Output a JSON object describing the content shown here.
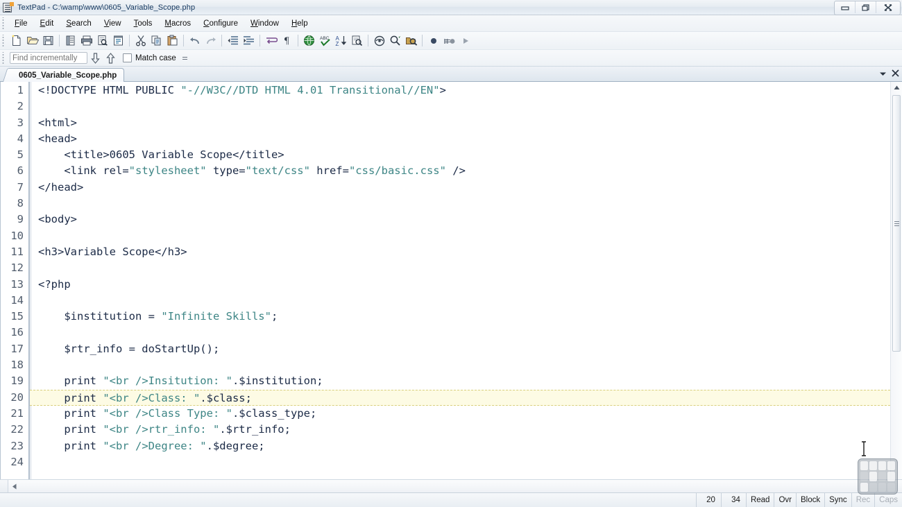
{
  "window": {
    "title": "TextPad - C:\\wamp\\www\\0605_Variable_Scope.php",
    "app_icon": "textpad-icon",
    "controls": {
      "minimize": "minimize-button",
      "restore": "restore-button",
      "close": "close-button"
    }
  },
  "menubar": {
    "items": [
      {
        "label": "File",
        "accel": "F"
      },
      {
        "label": "Edit",
        "accel": "E"
      },
      {
        "label": "Search",
        "accel": "S"
      },
      {
        "label": "View",
        "accel": "V"
      },
      {
        "label": "Tools",
        "accel": "T"
      },
      {
        "label": "Macros",
        "accel": "M"
      },
      {
        "label": "Configure",
        "accel": "C"
      },
      {
        "label": "Window",
        "accel": "W"
      },
      {
        "label": "Help",
        "accel": "H"
      }
    ]
  },
  "toolbar": {
    "buttons": [
      "new-file-icon",
      "open-file-icon",
      "save-file-icon",
      "sep",
      "document-properties-icon",
      "print-icon",
      "print-preview-icon",
      "document-view-icon",
      "sep",
      "cut-icon",
      "copy-icon",
      "paste-icon",
      "sep",
      "undo-icon",
      "redo-icon",
      "sep",
      "decrease-indent-icon",
      "increase-indent-icon",
      "sep",
      "word-wrap-icon",
      "show-paragraph-marks-icon",
      "sep",
      "web-preview-icon",
      "spell-check-icon",
      "sort-icon",
      "find-in-files-icon",
      "sep",
      "clip-library-icon",
      "find-next-icon",
      "find-tool-icon",
      "sep",
      "record-macro-icon",
      "pause-macro-icon",
      "play-macro-icon"
    ]
  },
  "findbar": {
    "input_value": "",
    "input_placeholder": "Find incrementally",
    "find_down_icon": "arrow-down-icon",
    "find_up_icon": "arrow-up-icon",
    "match_case_label": "Match case",
    "match_case_checked": false
  },
  "tabbar": {
    "tabs": [
      {
        "label": "0605_Variable_Scope.php",
        "active": true
      }
    ],
    "dropdown_icon": "chevron-down-icon",
    "close_icon": "close-icon"
  },
  "editor": {
    "current_line": 20,
    "lines": [
      {
        "n": "1",
        "tokens": [
          {
            "t": "<!DOCTYPE HTML PUBLIC ",
            "c": "txt"
          },
          {
            "t": "\"-//W3C//DTD HTML 4.01 Transitional//EN\"",
            "c": "str"
          },
          {
            "t": ">",
            "c": "txt"
          }
        ]
      },
      {
        "n": "2",
        "tokens": [
          {
            "t": "",
            "c": "txt"
          }
        ]
      },
      {
        "n": "3",
        "tokens": [
          {
            "t": "<html>",
            "c": "txt"
          }
        ]
      },
      {
        "n": "4",
        "tokens": [
          {
            "t": "<head>",
            "c": "txt"
          }
        ]
      },
      {
        "n": "5",
        "tokens": [
          {
            "t": "    <title>0605 Variable Scope</title>",
            "c": "txt"
          }
        ]
      },
      {
        "n": "6",
        "tokens": [
          {
            "t": "    <link rel=",
            "c": "txt"
          },
          {
            "t": "\"stylesheet\"",
            "c": "str"
          },
          {
            "t": " type=",
            "c": "txt"
          },
          {
            "t": "\"text/css\"",
            "c": "str"
          },
          {
            "t": " href=",
            "c": "txt"
          },
          {
            "t": "\"css/basic.css\"",
            "c": "str"
          },
          {
            "t": " />",
            "c": "txt"
          }
        ]
      },
      {
        "n": "7",
        "tokens": [
          {
            "t": "</head>",
            "c": "txt"
          }
        ]
      },
      {
        "n": "8",
        "tokens": [
          {
            "t": "",
            "c": "txt"
          }
        ]
      },
      {
        "n": "9",
        "tokens": [
          {
            "t": "<body>",
            "c": "txt"
          }
        ]
      },
      {
        "n": "10",
        "tokens": [
          {
            "t": "",
            "c": "txt"
          }
        ]
      },
      {
        "n": "11",
        "tokens": [
          {
            "t": "<h3>Variable Scope</h3>",
            "c": "txt"
          }
        ]
      },
      {
        "n": "12",
        "tokens": [
          {
            "t": "",
            "c": "txt"
          }
        ]
      },
      {
        "n": "13",
        "tokens": [
          {
            "t": "<?php",
            "c": "txt"
          }
        ]
      },
      {
        "n": "14",
        "tokens": [
          {
            "t": "",
            "c": "txt"
          }
        ]
      },
      {
        "n": "15",
        "tokens": [
          {
            "t": "    $institution = ",
            "c": "txt"
          },
          {
            "t": "\"Infinite Skills\"",
            "c": "str"
          },
          {
            "t": ";",
            "c": "txt"
          }
        ]
      },
      {
        "n": "16",
        "tokens": [
          {
            "t": "",
            "c": "txt"
          }
        ]
      },
      {
        "n": "17",
        "tokens": [
          {
            "t": "    $rtr_info = doStartUp();",
            "c": "txt"
          }
        ]
      },
      {
        "n": "18",
        "tokens": [
          {
            "t": "",
            "c": "txt"
          }
        ]
      },
      {
        "n": "19",
        "tokens": [
          {
            "t": "    print ",
            "c": "txt"
          },
          {
            "t": "\"<br />Insitution: \"",
            "c": "str"
          },
          {
            "t": ".$institution;",
            "c": "txt"
          }
        ]
      },
      {
        "n": "20",
        "tokens": [
          {
            "t": "    print ",
            "c": "txt"
          },
          {
            "t": "\"<br />Class: \"",
            "c": "str"
          },
          {
            "t": ".$class;",
            "c": "txt"
          }
        ]
      },
      {
        "n": "21",
        "tokens": [
          {
            "t": "    print ",
            "c": "txt"
          },
          {
            "t": "\"<br />Class Type: \"",
            "c": "str"
          },
          {
            "t": ".$class_type;",
            "c": "txt"
          }
        ]
      },
      {
        "n": "22",
        "tokens": [
          {
            "t": "    print ",
            "c": "txt"
          },
          {
            "t": "\"<br />rtr_info: \"",
            "c": "str"
          },
          {
            "t": ".$rtr_info;",
            "c": "txt"
          }
        ]
      },
      {
        "n": "23",
        "tokens": [
          {
            "t": "    print ",
            "c": "txt"
          },
          {
            "t": "\"<br />Degree: \"",
            "c": "str"
          },
          {
            "t": ".$degree;",
            "c": "txt"
          }
        ]
      },
      {
        "n": "24",
        "tokens": [
          {
            "t": "",
            "c": "txt"
          }
        ]
      }
    ],
    "colors": {
      "string": "#3d8585",
      "text": "#1b2a46",
      "current_line_bg": "#fdfbe4",
      "gutter_text": "#4f5b6b"
    }
  },
  "statusbar": {
    "line": "20",
    "column": "34",
    "read_mode": "Read",
    "overwrite_mode": "Ovr",
    "block_mode": "Block",
    "sync_mode": "Sync",
    "record_indicator": "Rec",
    "caps_indicator": "Caps"
  }
}
